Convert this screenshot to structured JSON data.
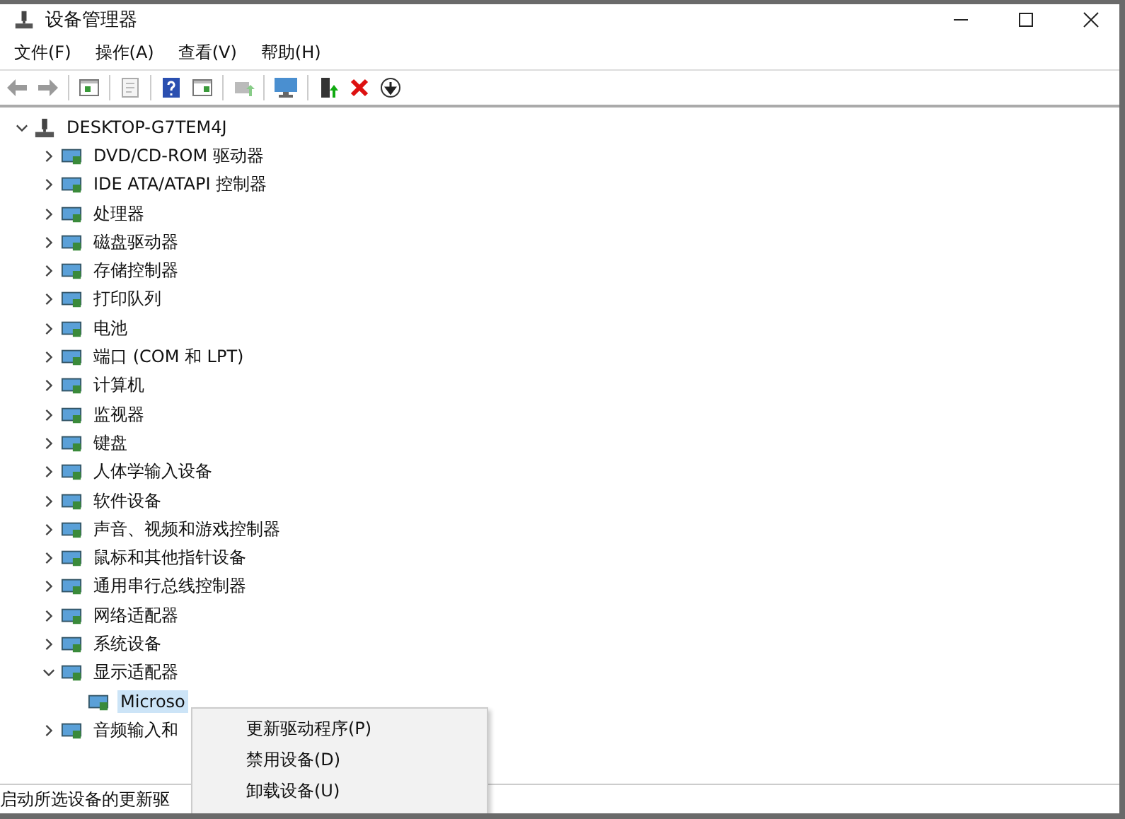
{
  "window": {
    "title": "设备管理器"
  },
  "menu": [
    {
      "label": "文件(F)"
    },
    {
      "label": "操作(A)"
    },
    {
      "label": "查看(V)"
    },
    {
      "label": "帮助(H)"
    }
  ],
  "toolbar": [
    {
      "kind": "back",
      "disabled": true
    },
    {
      "kind": "forward",
      "disabled": true
    },
    {
      "kind": "sep"
    },
    {
      "kind": "tree",
      "disabled": false
    },
    {
      "kind": "sep"
    },
    {
      "kind": "properties",
      "disabled": true
    },
    {
      "kind": "sep"
    },
    {
      "kind": "help",
      "disabled": false
    },
    {
      "kind": "pane",
      "disabled": false
    },
    {
      "kind": "sep"
    },
    {
      "kind": "scan",
      "disabled": true
    },
    {
      "kind": "sep"
    },
    {
      "kind": "monitor",
      "disabled": false
    },
    {
      "kind": "sep"
    },
    {
      "kind": "add",
      "disabled": false
    },
    {
      "kind": "remove",
      "disabled": false
    },
    {
      "kind": "down",
      "disabled": false
    }
  ],
  "tree": {
    "label": "DESKTOP-G7TEM4J",
    "expanded": true,
    "selected": false,
    "children": [
      {
        "label": "DVD/CD-ROM 驱动器",
        "expanded": false,
        "selected": false
      },
      {
        "label": "IDE ATA/ATAPI 控制器",
        "expanded": false,
        "selected": false
      },
      {
        "label": "处理器",
        "expanded": false,
        "selected": false
      },
      {
        "label": "磁盘驱动器",
        "expanded": false,
        "selected": false
      },
      {
        "label": "存储控制器",
        "expanded": false,
        "selected": false
      },
      {
        "label": "打印队列",
        "expanded": false,
        "selected": false
      },
      {
        "label": "电池",
        "expanded": false,
        "selected": false
      },
      {
        "label": "端口 (COM 和 LPT)",
        "expanded": false,
        "selected": false
      },
      {
        "label": "计算机",
        "expanded": false,
        "selected": false
      },
      {
        "label": "监视器",
        "expanded": false,
        "selected": false
      },
      {
        "label": "键盘",
        "expanded": false,
        "selected": false
      },
      {
        "label": "人体学输入设备",
        "expanded": false,
        "selected": false
      },
      {
        "label": "软件设备",
        "expanded": false,
        "selected": false
      },
      {
        "label": "声音、视频和游戏控制器",
        "expanded": false,
        "selected": false
      },
      {
        "label": "鼠标和其他指针设备",
        "expanded": false,
        "selected": false
      },
      {
        "label": "通用串行总线控制器",
        "expanded": false,
        "selected": false
      },
      {
        "label": "网络适配器",
        "expanded": false,
        "selected": false
      },
      {
        "label": "系统设备",
        "expanded": false,
        "selected": false
      },
      {
        "label": "显示适配器",
        "expanded": true,
        "selected": false,
        "children": [
          {
            "label": "Microso",
            "selected": true
          }
        ]
      },
      {
        "label": "音频输入和",
        "expanded": false,
        "selected": false
      }
    ]
  },
  "context_menu": [
    {
      "label": "更新驱动程序(P)"
    },
    {
      "label": "禁用设备(D)"
    },
    {
      "label": "卸载设备(U)"
    }
  ],
  "status_bar": "启动所选设备的更新驱"
}
